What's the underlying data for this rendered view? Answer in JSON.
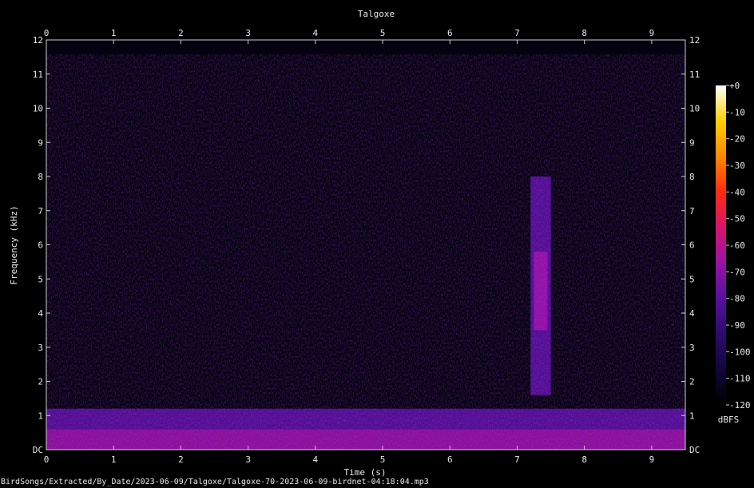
{
  "chart_data": {
    "type": "heatmap",
    "title": "Talgoxe",
    "xlabel": "Time (s)",
    "ylabel": "Frequency (kHz)",
    "xlim": [
      0,
      9.5
    ],
    "ylim": [
      0,
      12
    ],
    "x_ticks": [
      0,
      1,
      2,
      3,
      4,
      5,
      6,
      7,
      8,
      9
    ],
    "y_ticks": [
      "DC",
      "1",
      "2",
      "3",
      "4",
      "5",
      "6",
      "7",
      "8",
      "9",
      "10",
      "11",
      "12"
    ],
    "colorbar": {
      "label": "dBFS",
      "range": [
        -120,
        0
      ],
      "ticks": [
        "+0",
        "-10",
        "-20",
        "-30",
        "-40",
        "-50",
        "-60",
        "-70",
        "-80",
        "-90",
        "-100",
        "-110",
        "-120"
      ],
      "stops": [
        "#000000",
        "#12063a",
        "#2a0c6e",
        "#5a0fa0",
        "#9a12a8",
        "#d6156e",
        "#ff2a10",
        "#ff8800",
        "#ffd000",
        "#ffffff"
      ]
    },
    "features": [
      {
        "t_start": 0.0,
        "t_end": 9.5,
        "f_low": 0.0,
        "f_high": 0.6,
        "level_dbfs": -68
      },
      {
        "t_start": 0.0,
        "t_end": 9.5,
        "f_low": 0.6,
        "f_high": 1.2,
        "level_dbfs": -82
      },
      {
        "t_start": 7.2,
        "t_end": 7.5,
        "f_low": 1.6,
        "f_high": 8.0,
        "level_dbfs": -74
      },
      {
        "t_start": 7.25,
        "t_end": 7.45,
        "f_low": 3.5,
        "f_high": 5.8,
        "level_dbfs": -66
      }
    ]
  },
  "footer_path": "BirdSongs/Extracted/By_Date/2023-06-09/Talgoxe/Talgoxe-70-2023-06-09-birdnet-04:18:04.mp3"
}
